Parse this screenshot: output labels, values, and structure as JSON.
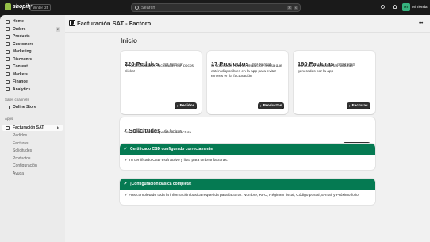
{
  "topbar": {
    "brand": "shopify",
    "edition": "Winter '25",
    "search_placeholder": "Search",
    "shortcut_keys": [
      "⌘",
      "K"
    ],
    "avatar_initials": "MT",
    "store_name": "Mi Tienda"
  },
  "sidebar": {
    "items": [
      {
        "label": "Home"
      },
      {
        "label": "Orders",
        "badge": "2"
      },
      {
        "label": "Products"
      },
      {
        "label": "Customers"
      },
      {
        "label": "Marketing"
      },
      {
        "label": "Discounts"
      },
      {
        "label": "Content"
      },
      {
        "label": "Markets"
      },
      {
        "label": "Finance"
      },
      {
        "label": "Analytics"
      }
    ],
    "sales_channels_label": "Sales channels",
    "online_store": "Online Store",
    "apps_label": "Apps",
    "app_name": "Facturación SAT",
    "app_subitems": [
      "Pedidos",
      "Facturas",
      "Solicitudes",
      "Productos",
      "Configuración",
      "Ayuda"
    ]
  },
  "main": {
    "app_title": "Facturación SAT - Factoro",
    "page_title": "Inicio",
    "cards": [
      {
        "count": "220 Pedidos",
        "suffix": "por facturar",
        "desc": "¡Pedidos pagados, facturados con pocos clicks!",
        "button": "Pedidos"
      },
      {
        "count": "17 Productos",
        "suffix": "por revisar",
        "desc": "Si agregaste nuevos productos revisa que estén disponibles en la app para evitar errores en la facturación",
        "button": "Productos"
      },
      {
        "count": "160 Facturas",
        "suffix": "timbradas",
        "desc": "Consulta y descarga las facturas generadas por la app",
        "button": "Facturas"
      }
    ],
    "requests_card": {
      "count": "7 Solicitudes",
      "suffix": "de factura",
      "desc": "Tus clientes están esperando su factura.",
      "button": "Solicitudes"
    },
    "banners": [
      {
        "title": "Certificado CSD configurado correctamente",
        "body": "Tu certificado CSD está activo y listo para timbrar facturas."
      },
      {
        "title": "¡Configuración básica completa!",
        "body": "Has completado toda la información básica requerida para facturar: Nombre, RFC, Régimen fiscal, Código postal, E-mail y Próximo folio."
      }
    ]
  },
  "colors": {
    "success": "#057a52",
    "button": "#303030",
    "sidebar": "#ebebeb",
    "background": "#f1f1f1"
  }
}
